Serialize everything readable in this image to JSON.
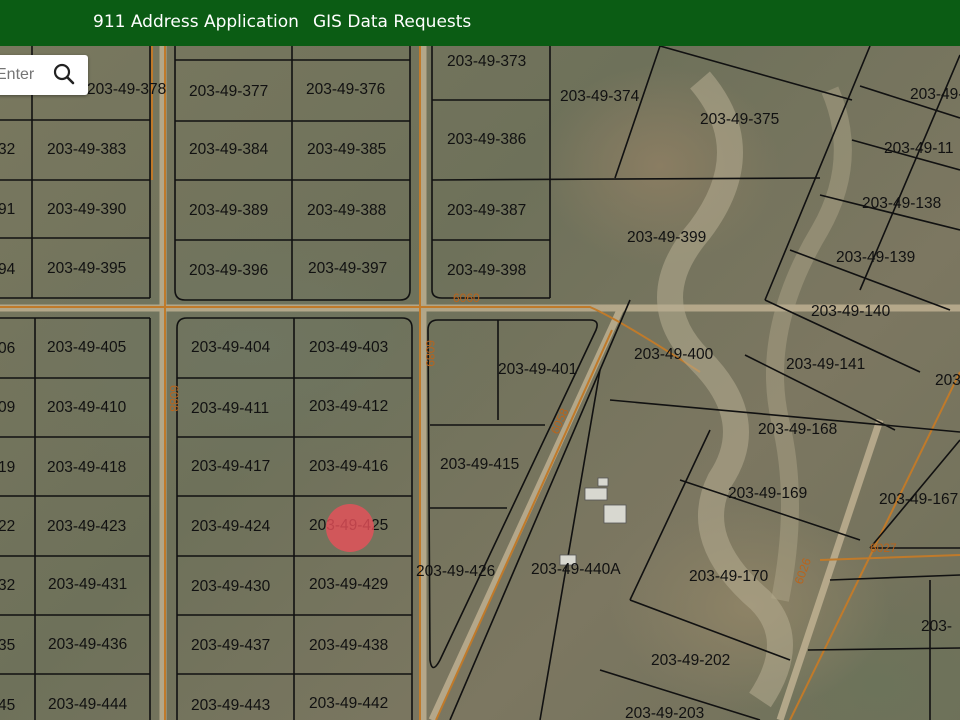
{
  "nav": {
    "items": [
      {
        "label": "911 Address Application"
      },
      {
        "label": "GIS Data Requests"
      }
    ]
  },
  "search": {
    "placeholder": "Enter"
  },
  "colors": {
    "header": "#0b5c14",
    "parcel_line": "#111111",
    "road": "#c07a2a",
    "marker": "#e8505a"
  },
  "map": {
    "parcels": [
      "203-49-378",
      "203-49-377",
      "203-49-376",
      "203-49-373",
      "203-49-374",
      "203-49-375",
      "203-49-",
      "203-49-383",
      "203-49-384",
      "203-49-385",
      "203-49-386",
      "203-49-11",
      "203-49-390",
      "203-49-389",
      "203-49-388",
      "203-49-387",
      "203-49-138",
      "203-49-395",
      "203-49-396",
      "203-49-397",
      "203-49-398",
      "203-49-399",
      "203-49-139",
      "203-49-405",
      "203-49-404",
      "203-49-403",
      "203-49-401",
      "203-49-400",
      "203-49-140",
      "203-49-141",
      "203-49-410",
      "203-49-411",
      "203-49-412",
      "203-49-168",
      "203-49-418",
      "203-49-417",
      "203-49-416",
      "203-49-415",
      "203-49-169",
      "203-49-167",
      "203-49-423",
      "203-49-424",
      "203-49-425",
      "203-49-426",
      "203-49-440A",
      "203-49-170",
      "203-49-431",
      "203-49-430",
      "203-49-429",
      "203-49-436",
      "203-49-437",
      "203-49-438",
      "203-49-202",
      "203-49-444",
      "203-49-443",
      "203-49-442",
      "203-49-203",
      "32",
      "91",
      "94",
      "06",
      "09",
      "19",
      "22",
      "32",
      "35",
      "45"
    ],
    "roads": [
      "6060",
      "6089",
      "6088",
      "6058",
      "6026",
      "6027"
    ]
  }
}
